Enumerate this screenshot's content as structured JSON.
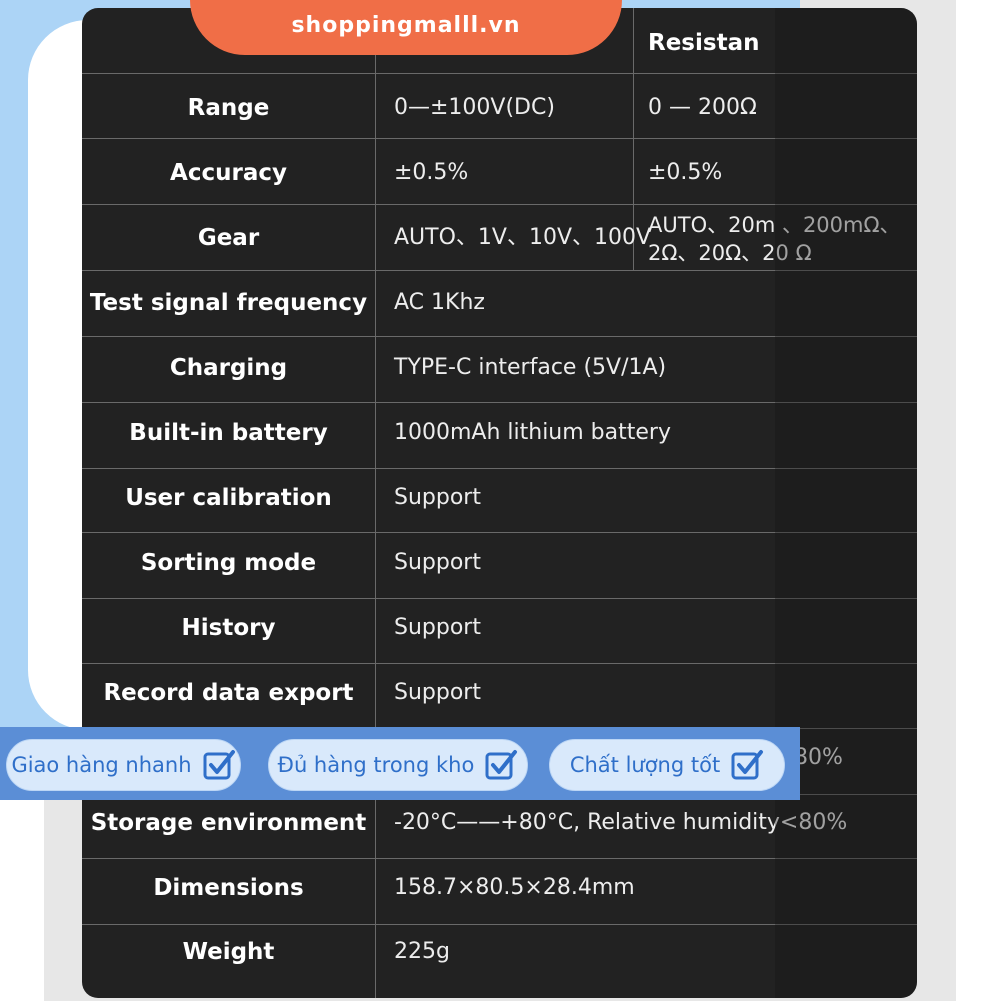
{
  "banner": {
    "text": "shoppingmalll.vn"
  },
  "table": {
    "header_col2": "Resistan",
    "rows": [
      {
        "label": "Range",
        "v1": "0—±100V(DC)",
        "v2": "0 — 200Ω"
      },
      {
        "label": "Accuracy",
        "v1": "±0.5%",
        "v2": "±0.5%"
      },
      {
        "label": "Gear",
        "v1": "AUTO、1V、10V、100V",
        "v2a": "AUTO、20m 、200mΩ、",
        "v2b": "2Ω、20Ω、20  Ω"
      },
      {
        "label": "Test signal frequency",
        "v1": "AC 1Khz"
      },
      {
        "label": "Charging",
        "v1": "TYPE-C interface (5V/1A)"
      },
      {
        "label": "Built-in battery",
        "v1": "1000mAh lithium battery"
      },
      {
        "label": "User calibration",
        "v1": "Support"
      },
      {
        "label": "Sorting mode",
        "v1": "Support"
      },
      {
        "label": "History",
        "v1": "Support"
      },
      {
        "label": "Record data export",
        "v1": "Support"
      },
      {
        "label": "",
        "v1": "80%"
      },
      {
        "label": "Storage environment",
        "v1": "-20°C——+80°C, Relative humidity<80%"
      },
      {
        "label": "Dimensions",
        "v1": "158.7×80.5×28.4mm"
      },
      {
        "label": "Weight",
        "v1": "225g"
      }
    ]
  },
  "badges": [
    {
      "text": "Giao hàng nhanh",
      "icon": "checkbox-icon"
    },
    {
      "text": "Đủ hàng trong kho",
      "icon": "checkbox-icon"
    },
    {
      "text": "Chất lượng tốt",
      "icon": "checkbox-icon"
    }
  ],
  "colors": {
    "banner": "#f06e47",
    "frame": "#acd4f6",
    "card": "#222222",
    "badge_text": "#2f6fc9"
  }
}
